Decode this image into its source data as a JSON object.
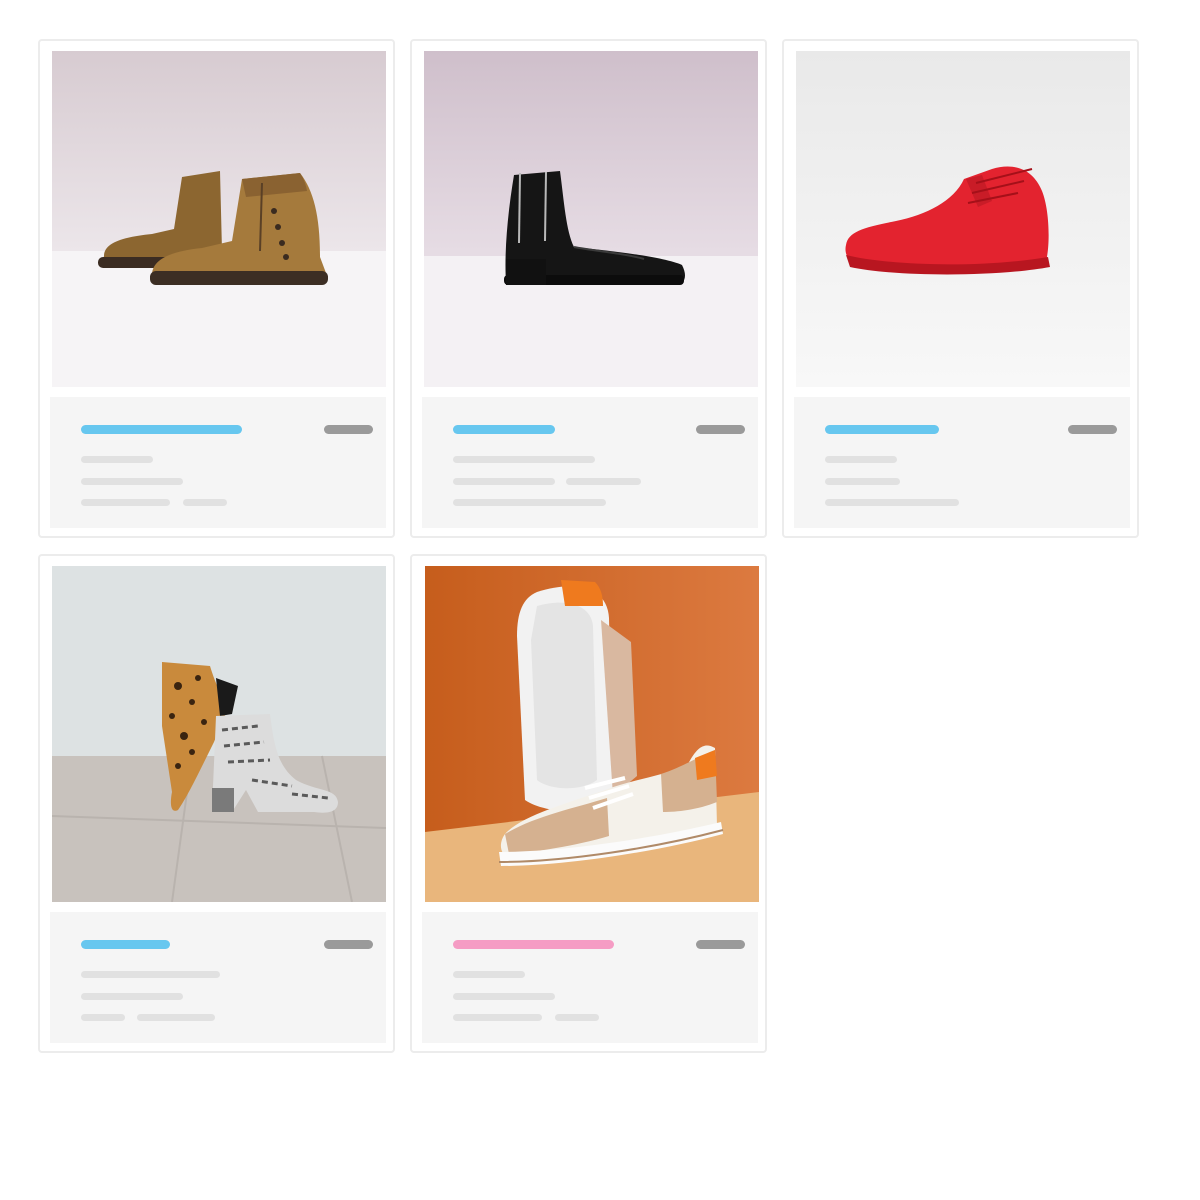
{
  "products": [
    {
      "image": "brown-suede-ankle-boots-photo",
      "title_accent": "#67c7ef",
      "price_color": "#9a9a9a"
    },
    {
      "image": "black-leather-zip-boot-photo",
      "title_accent": "#67c7ef",
      "price_color": "#9a9a9a"
    },
    {
      "image": "red-high-top-sneaker-photo",
      "title_accent": "#67c7ef",
      "price_color": "#9a9a9a"
    },
    {
      "image": "leopard-and-snakeskin-heeled-boots-photo",
      "title_accent": "#67c7ef",
      "price_color": "#9a9a9a"
    },
    {
      "image": "white-tan-sneakers-orange-backdrop-photo",
      "title_accent": "#f59cc4",
      "price_color": "#9a9a9a"
    }
  ]
}
